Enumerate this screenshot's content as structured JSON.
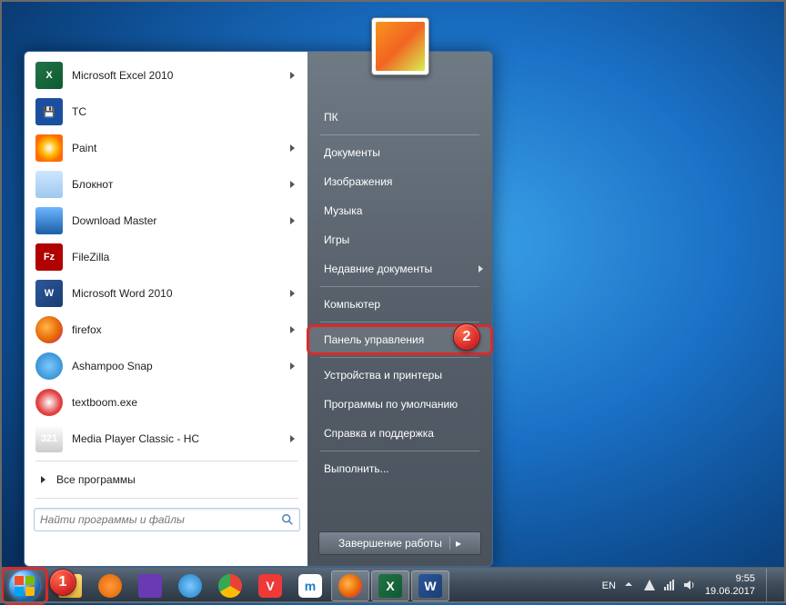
{
  "start_menu": {
    "left_items": [
      {
        "label": "Microsoft Excel 2010",
        "icon": "excel",
        "has_submenu": true
      },
      {
        "label": "TC",
        "icon": "tc",
        "has_submenu": false
      },
      {
        "label": "Paint",
        "icon": "paint",
        "has_submenu": true
      },
      {
        "label": "Блокнот",
        "icon": "notepad",
        "has_submenu": true
      },
      {
        "label": "Download Master",
        "icon": "dm",
        "has_submenu": true
      },
      {
        "label": "FileZilla",
        "icon": "filezilla",
        "has_submenu": false
      },
      {
        "label": "Microsoft Word 2010",
        "icon": "word",
        "has_submenu": true
      },
      {
        "label": "firefox",
        "icon": "firefox",
        "has_submenu": true
      },
      {
        "label": "Ashampoo Snap",
        "icon": "snap",
        "has_submenu": true
      },
      {
        "label": "textboom.exe",
        "icon": "textboom",
        "has_submenu": false
      },
      {
        "label": "Media Player Classic - HC",
        "icon": "mpc",
        "has_submenu": true
      }
    ],
    "all_programs_label": "Все программы",
    "search_placeholder": "Найти программы и файлы",
    "right_items": [
      {
        "label": "ПК",
        "has_submenu": false
      },
      {
        "label": "Документы",
        "has_submenu": false
      },
      {
        "label": "Изображения",
        "has_submenu": false
      },
      {
        "label": "Музыка",
        "has_submenu": false
      },
      {
        "label": "Игры",
        "has_submenu": false
      },
      {
        "label": "Недавние документы",
        "has_submenu": true
      },
      {
        "label": "Компьютер",
        "has_submenu": false
      },
      {
        "label": "Панель управления",
        "has_submenu": false,
        "highlight": true
      },
      {
        "label": "Устройства и принтеры",
        "has_submenu": false
      },
      {
        "label": "Программы по умолчанию",
        "has_submenu": false
      },
      {
        "label": "Справка и поддержка",
        "has_submenu": false
      },
      {
        "label": "Выполнить...",
        "has_submenu": false
      }
    ],
    "shutdown_label": "Завершение работы"
  },
  "annotations": {
    "badge1": "1",
    "badge2": "2"
  },
  "tray": {
    "lang": "EN",
    "time": "9:55",
    "date": "19.06.2017"
  }
}
